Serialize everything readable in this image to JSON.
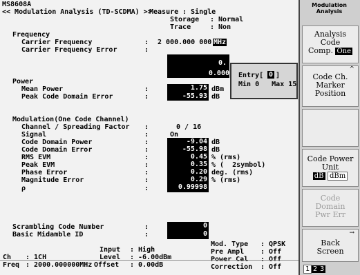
{
  "header": {
    "id": "MS8608A",
    "title": "<< Modulation Analysis (TD-SCDMA) >>",
    "rows": [
      {
        "k": "Measure",
        "v": ": Single"
      },
      {
        "k": "Storage",
        "v": ": Normal"
      },
      {
        "k": "Trace",
        "v": ": Non"
      }
    ]
  },
  "frequency": {
    "section": "Frequency",
    "carrier_label": "Carrier Frequency",
    "carrier_value": "2 000.000 000 0",
    "carrier_unit": "MHz",
    "error_label": "Carrier Frequency Error",
    "error_value": "0.",
    "error_value2": "0.000",
    "colon": ":"
  },
  "power": {
    "section": "Power",
    "mean_label": "Mean Power",
    "mean_value": "1.75",
    "mean_unit": "dBm",
    "pcde_label": "Peak Code Domain Error",
    "pcde_value": "-55.93",
    "pcde_unit": "dB"
  },
  "modulation": {
    "section": "Modulation(One Code Channel)",
    "rows": [
      {
        "label": "Channel / Spreading Factor",
        "value": "0 / 16",
        "unit": ""
      },
      {
        "label": "Signal",
        "value": "On",
        "unit": ""
      },
      {
        "label": "Code Domain Power",
        "value": "-9.04",
        "unit": "dB"
      },
      {
        "label": "Code Domain Error",
        "value": "-55.98",
        "unit": "dB"
      },
      {
        "label": "RMS EVM",
        "value": "0.45",
        "unit": "% (rms)"
      },
      {
        "label": "Peak EVM",
        "value": "0.35",
        "unit": "% (  2symbol)"
      },
      {
        "label": "Phase Error",
        "value": "0.20",
        "unit": "deg. (rms)"
      },
      {
        "label": "Magnitude Error",
        "value": "0.29",
        "unit": "% (rms)"
      },
      {
        "label": "ρ",
        "value": "0.99998",
        "unit": ""
      }
    ]
  },
  "codes": {
    "scrambling_label": "Scrambling Code Number",
    "scrambling_value": "0",
    "midamble_label": "Basic Midamble ID",
    "midamble_value": "0"
  },
  "popup": {
    "entry_label": "Entry[",
    "entry_value": "0",
    "entry_close": "]",
    "range": "Min 0   Max 15"
  },
  "status": {
    "input_label": "Input",
    "input_value": ": High",
    "level_label": "Level",
    "level_value": ": -6.00dBm",
    "offset_label": "Offset",
    "offset_value": ": 0.00dB",
    "ch_label": "Ch",
    "ch_value": ": 1CH",
    "freq_label": "Freq",
    "freq_value": ": 2000.000000MHz",
    "modtype_label": "Mod. Type",
    "modtype_value": ": QPSK",
    "preampl_label": "Pre Ampl",
    "preampl_value": ": Off",
    "powercal_label": "Power Cal",
    "powercal_value": ": Off",
    "correction_label": "Correction",
    "correction_value": ": Off"
  },
  "softkeys": {
    "menu_title": [
      "Modulation",
      "Analysis"
    ],
    "f1": {
      "lines": [
        "Analysis",
        "Code"
      ],
      "line3_prefix": "Comp.",
      "line3_opt": "One"
    },
    "f2": {
      "lines": [
        "Code Ch.",
        "Marker",
        "Position"
      ],
      "marker": "^"
    },
    "f3": {
      "lines": []
    },
    "f4": {
      "lines": [
        "Code Power",
        "Unit"
      ],
      "opt_on": "dB",
      "opt_off": "dBm"
    },
    "f5": {
      "lines": [
        "Code",
        "Domain",
        "Pwr   Err"
      ]
    },
    "f6": {
      "lines": [
        "Back",
        "Screen"
      ],
      "marker": "→",
      "pages": [
        "1",
        "2",
        "3"
      ]
    }
  }
}
